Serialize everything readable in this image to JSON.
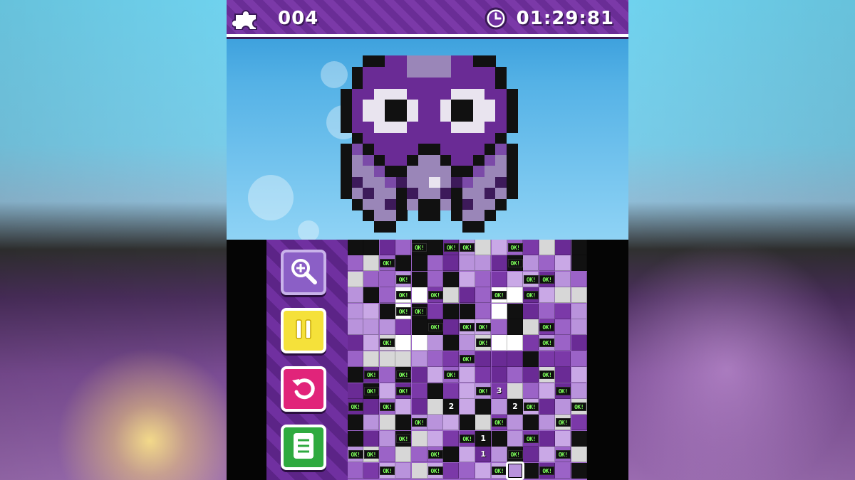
{
  "hud": {
    "pieces_count": "004",
    "timer": "01:29:81",
    "icons": {
      "pieces": "puzzle-piece-icon",
      "timer": "clock-icon"
    }
  },
  "sidebar": {
    "buttons": [
      {
        "id": "zoom",
        "icon": "zoom-in-icon",
        "color": "#8b5fc6"
      },
      {
        "id": "pause",
        "icon": "pause-icon",
        "color": "#f5e13a"
      },
      {
        "id": "undo",
        "icon": "undo-icon",
        "color": "#e1247a"
      },
      {
        "id": "menu",
        "icon": "menu-list-icon",
        "color": "#2faa3f"
      }
    ]
  },
  "board": {
    "ok_label": "OK!",
    "hints": [
      "3",
      "2",
      "2",
      "1",
      "1"
    ]
  },
  "colors": {
    "hud_purple": "#7030a0",
    "ok_green": "#7dff5a",
    "sprite_purple": "#6a2b95",
    "sprite_light": "#9a86b8",
    "sky": "#55b2e6"
  }
}
